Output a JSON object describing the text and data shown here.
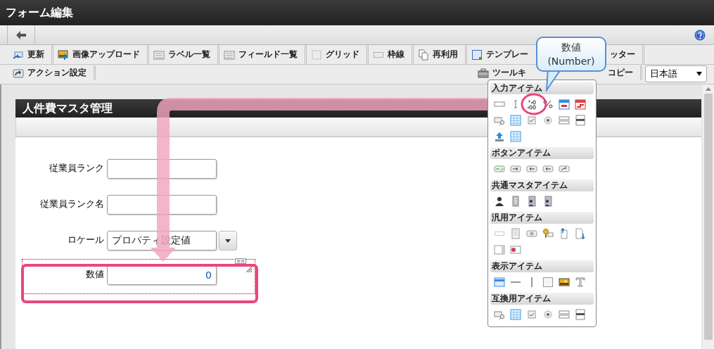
{
  "window": {
    "title": "フォーム編集"
  },
  "toolbar_rows": [
    {
      "items": [
        {
          "label": "更新"
        },
        {
          "label": "画像アップロード"
        },
        {
          "label": "ラベル一覧"
        },
        {
          "label": "フィールド一覧"
        },
        {
          "label": "グリッド"
        },
        {
          "label": "枠線"
        },
        {
          "label": "再利用"
        },
        {
          "label": "テンプレー"
        },
        {
          "label": "ッター"
        }
      ]
    },
    {
      "items": [
        {
          "label": "アクション設定"
        },
        {
          "label": "ツールキ"
        },
        {
          "label": "コピー"
        }
      ]
    }
  ],
  "language_select": {
    "value": "日本語"
  },
  "form": {
    "title": "人件費マスタ管理",
    "fields": [
      {
        "label": "従業員ランク",
        "kind": "text"
      },
      {
        "label": "従業員ランク名",
        "kind": "text"
      },
      {
        "label": "ロケール",
        "kind": "select",
        "value": "プロパティ設定値"
      },
      {
        "label": "数値",
        "kind": "number",
        "value": "0",
        "selected": true
      }
    ]
  },
  "palette": {
    "sections": [
      {
        "title": "入力アイテム"
      },
      {
        "title": "ボタンアイテム"
      },
      {
        "title": "共通マスタアイテム"
      },
      {
        "title": "汎用アイテム"
      },
      {
        "title": "表示アイテム"
      },
      {
        "title": "互換用アイテム"
      }
    ]
  },
  "callout": {
    "lines": [
      "数値",
      "(Number)"
    ]
  }
}
